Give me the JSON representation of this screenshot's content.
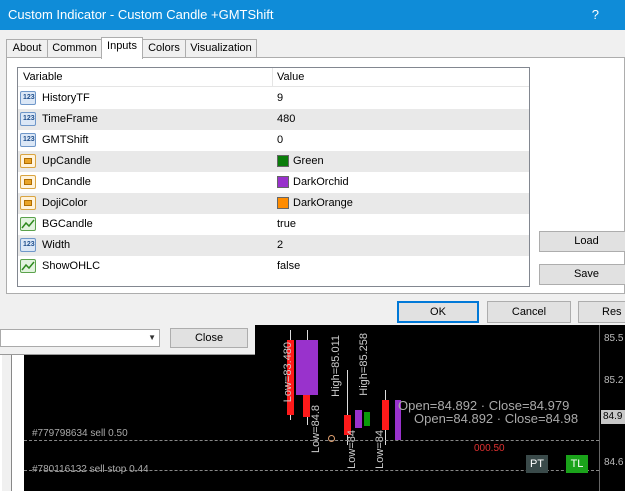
{
  "window": {
    "title": "Custom Indicator - Custom Candle +GMTShift",
    "help": "?"
  },
  "tabs": [
    {
      "label": "About"
    },
    {
      "label": "Common"
    },
    {
      "label": "Inputs"
    },
    {
      "label": "Colors"
    },
    {
      "label": "Visualization"
    }
  ],
  "inputs": {
    "columns": {
      "variable": "Variable",
      "value": "Value"
    },
    "rows": [
      {
        "name": "HistoryTF",
        "value": "9",
        "type": "int"
      },
      {
        "name": "TimeFrame",
        "value": "480",
        "type": "int"
      },
      {
        "name": "GMTShift",
        "value": "0",
        "type": "int"
      },
      {
        "name": "UpCandle",
        "value": "Green",
        "type": "color",
        "color": "#0a7d0a"
      },
      {
        "name": "DnCandle",
        "value": "DarkOrchid",
        "type": "color",
        "color": "#9932cc"
      },
      {
        "name": "DojiColor",
        "value": "DarkOrange",
        "type": "color",
        "color": "#ff8c00"
      },
      {
        "name": "BGCandle",
        "value": "true",
        "type": "bool"
      },
      {
        "name": "Width",
        "value": "2",
        "type": "int"
      },
      {
        "name": "ShowOHLC",
        "value": "false",
        "type": "bool"
      }
    ]
  },
  "buttons": {
    "load": "Load",
    "save": "Save",
    "ok": "OK",
    "cancel": "Cancel",
    "reset": "Res"
  },
  "background": {
    "close_button": "Close",
    "orders": [
      "#779798634 sell 0.50",
      "#780116132 sell stop 0.44"
    ],
    "prices": [
      "85.5",
      "85.2",
      "84.9",
      "84.6"
    ],
    "ohlc_line1": "Open=84.892 · Close=84.979",
    "ohlc_line2": "Open=84.892 · Close=84.98",
    "vertical_labels": [
      "Low=83.480",
      "High=85.011",
      "High=85.258",
      "Low=84.8",
      "Low=84",
      "Low=84"
    ],
    "red_value": "000.50",
    "badges": [
      "PT",
      "TL"
    ]
  }
}
